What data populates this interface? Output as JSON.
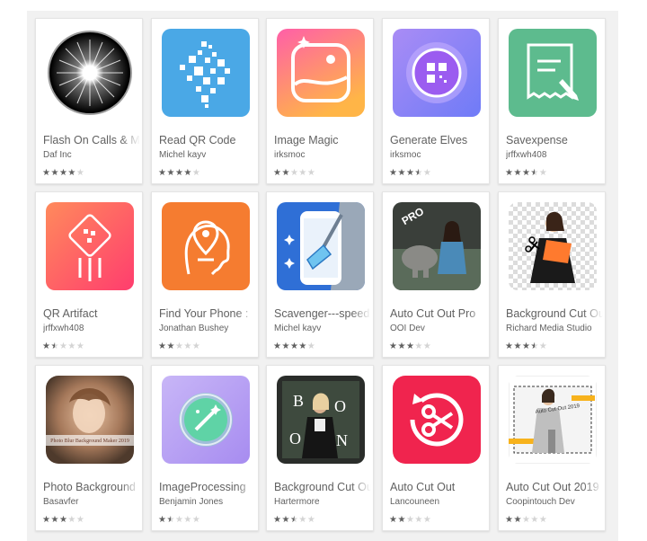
{
  "apps": [
    {
      "title": "Flash On Calls & M",
      "developer": "Daf Inc",
      "rating": 4,
      "icon": "flash-burst-icon",
      "colors": [
        "#000000",
        "#ffffff"
      ]
    },
    {
      "title": "Read QR Code",
      "developer": "Michel kayv",
      "rating": 4,
      "icon": "qr-code-icon",
      "colors": [
        "#4aa8e6"
      ]
    },
    {
      "title": "Image Magic",
      "developer": "irksmoc",
      "rating": 2,
      "icon": "image-magic-icon",
      "colors": [
        "#ff5fa8",
        "#ffb547"
      ]
    },
    {
      "title": "Generate Elves",
      "developer": "irksmoc",
      "rating": 3.5,
      "icon": "qr-circle-icon",
      "colors": [
        "#a98cf5",
        "#6f7bf7"
      ]
    },
    {
      "title": "Savexpense",
      "developer": "jrffxwh408",
      "rating": 3.5,
      "icon": "receipt-pen-icon",
      "colors": [
        "#5dbb8e"
      ]
    },
    {
      "title": "QR Artifact",
      "developer": "jrffxwh408",
      "rating": 1.5,
      "icon": "qr-rocket-icon",
      "colors": [
        "#ff6a5c",
        "#ff3d6e"
      ]
    },
    {
      "title": "Find Your Phone :",
      "developer": "Jonathan Bushey",
      "rating": 2,
      "icon": "location-head-icon",
      "colors": [
        "#ff8a3d",
        "#f06a2a"
      ]
    },
    {
      "title": "Scavenger---speed",
      "developer": "Michel kayv",
      "rating": 4,
      "icon": "broom-phone-icon",
      "colors": [
        "#2f6fd6",
        "#9aa8b8"
      ]
    },
    {
      "title": "Auto Cut Out Pro",
      "developer": "OOI Dev",
      "rating": 3,
      "icon": "cutout-pro-icon",
      "colors": [
        "#3a3f3a"
      ]
    },
    {
      "title": "Background Cut Ou",
      "developer": "Richard Media Studio",
      "rating": 3.5,
      "icon": "cutout-person-icon",
      "colors": [
        "#ff7a2e"
      ]
    },
    {
      "title": "Photo Background",
      "developer": "Basavfer",
      "rating": 3,
      "icon": "photo-blur-icon",
      "colors": [
        "#b98b6e"
      ]
    },
    {
      "title": "ImageProcessing",
      "developer": "Benjamin Jones",
      "rating": 1.5,
      "icon": "image-processing-icon",
      "colors": [
        "#c5b8f5",
        "#8ee0c2"
      ]
    },
    {
      "title": "Background Cut Ou",
      "developer": "Hartermore",
      "rating": 2.5,
      "icon": "boon-cutout-icon",
      "colors": [
        "#2a2d2a"
      ]
    },
    {
      "title": "Auto Cut Out",
      "developer": "Lancouneen",
      "rating": 2,
      "icon": "scissors-refresh-icon",
      "colors": [
        "#f0244e"
      ]
    },
    {
      "title": "Auto Cut Out 2019",
      "developer": "Coopintouch Dev",
      "rating": 2,
      "icon": "cutout-2019-icon",
      "colors": [
        "#f7b21c"
      ]
    }
  ],
  "icon_text": {
    "pro_badge": "PRO",
    "photo_blur_caption": "Photo Blur Background Maker 2019",
    "boon_letters": [
      "B",
      "O",
      "O",
      "N"
    ],
    "auto_cut_caption": "Auto Cut Out 2019"
  }
}
